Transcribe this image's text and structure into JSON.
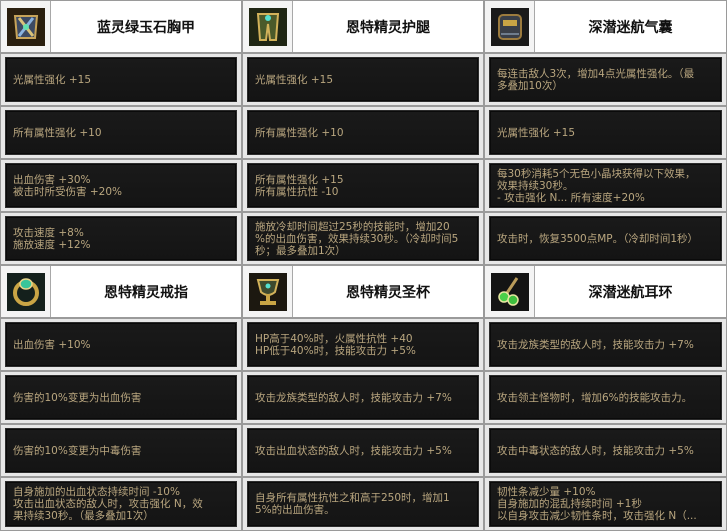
{
  "items": [
    {
      "name": "蓝灵绿玉石胸甲",
      "icon": "armor-icon",
      "stats": [
        [
          "光属性强化 +15"
        ],
        [
          "所有属性强化 +10"
        ],
        [
          "出血伤害 +30%",
          "被击时所受伤害 +20%"
        ],
        [
          "攻击速度 +8%",
          "施放速度 +12%"
        ]
      ]
    },
    {
      "name": "恩特精灵护腿",
      "icon": "leggings-icon",
      "stats": [
        [
          "光属性强化 +15"
        ],
        [
          "所有属性强化 +10"
        ],
        [
          "所有属性强化 +15",
          "所有属性抗性 -10"
        ],
        [
          "施放冷却时间超过25秒的技能时，增加20",
          "%的出血伤害，效果持续30秒。（冷却时间5",
          "秒；最多叠加1次）"
        ]
      ]
    },
    {
      "name": "深潜迷航气囊",
      "icon": "airbag-icon",
      "stats": [
        [
          "每连击敌人3次，增加4点光属性强化。（最",
          "多叠加10次）"
        ],
        [
          "光属性强化 +15"
        ],
        [
          "每30秒消耗5个无色小晶块获得以下效果，",
          "效果持续30秒。",
          "- 攻击强化 N... 所有速度+20%"
        ],
        [
          "攻击时，恢复3500点MP。（冷却时间1秒）"
        ]
      ]
    },
    {
      "name": "恩特精灵戒指",
      "icon": "ring-icon",
      "stats": [
        [
          "出血伤害 +10%"
        ],
        [
          "伤害的10%变更为出血伤害"
        ],
        [
          "伤害的10%变更为中毒伤害"
        ],
        [
          "自身施加的出血状态持续时间 -10%",
          "攻击出血状态的敌人时，攻击强化 N，效",
          "果持续30秒。（最多叠加1次）"
        ]
      ]
    },
    {
      "name": "恩特精灵圣杯",
      "icon": "chalice-icon",
      "stats": [
        [
          "HP高于40%时，火属性抗性 +40",
          "HP低于40%时，技能攻击力 +5%"
        ],
        [
          "攻击龙族类型的敌人时，技能攻击力 +7%"
        ],
        [
          "攻击出血状态的敌人时，技能攻击力 +5%"
        ],
        [
          "自身所有属性抗性之和高于250时，增加1",
          "5%的出血伤害。"
        ]
      ]
    },
    {
      "name": "深潜迷航耳环",
      "icon": "earring-icon",
      "stats": [
        [
          "攻击龙族类型的敌人时，技能攻击力 +7%"
        ],
        [
          "攻击领主怪物时，增加6%的技能攻击力。"
        ],
        [
          "攻击中毒状态的敌人时，技能攻击力 +5%"
        ],
        [
          "韧性条减少量 +10%",
          "自身施加的混乱持续时间 +1秒",
          "以自身攻击减少韧性条时，攻击强化 N（..."
        ]
      ]
    }
  ]
}
